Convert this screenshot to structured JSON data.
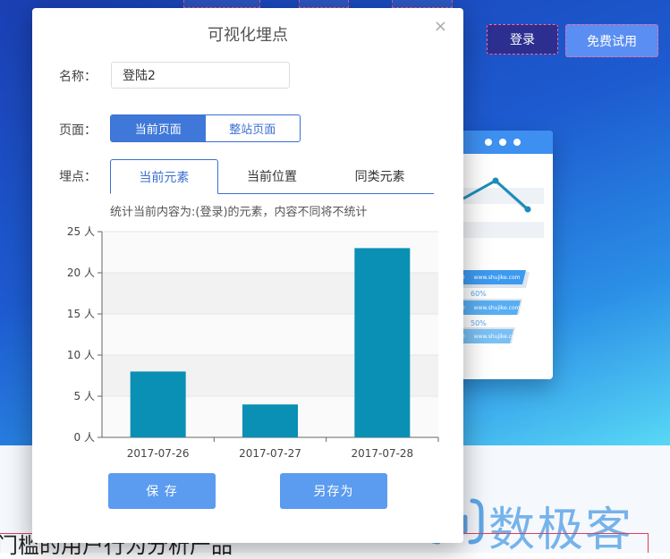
{
  "header": {
    "login_label": "登录",
    "trial_label": "免费试用"
  },
  "modal": {
    "title": "可视化埋点",
    "close_glyph": "×",
    "name_label": "名称：",
    "name_value": "登陆2",
    "page_label": "页面：",
    "page_options": [
      "当前页面",
      "整站页面"
    ],
    "page_selected": 0,
    "point_label": "埋点：",
    "point_tabs": [
      "当前元素",
      "当前位置",
      "同类元素"
    ],
    "point_selected": 0,
    "stat_note": "统计当前内容为:(登录)的元素，内容不同将不统计",
    "save_label": "保 存",
    "save_as_label": "另存为"
  },
  "chart_data": {
    "type": "bar",
    "categories": [
      "2017-07-26",
      "2017-07-27",
      "2017-07-28"
    ],
    "values": [
      8,
      4,
      23
    ],
    "ylim": [
      0,
      25
    ],
    "yticks": [
      "0 人",
      "5 人",
      "10 人",
      "15 人",
      "20 人",
      "25 人"
    ],
    "ytick_values": [
      0,
      5,
      10,
      15,
      20,
      25
    ],
    "bar_color": "#0a8fb5",
    "grid": true
  },
  "device": {
    "funnel_items": [
      "www.shujike.com",
      "www.shujike.com",
      "www.shujike.com"
    ],
    "funnel_prefix": [
      "00",
      "00",
      "00"
    ],
    "funnel_pcts": [
      "60%",
      "50%"
    ]
  },
  "logo": {
    "text": "数极客"
  },
  "page_bottom": {
    "text": "门槛的用户行为分析产品"
  },
  "colors": {
    "accent": "#3b6fd0",
    "button": "#5b9bf0",
    "bar": "#0a8fb5"
  }
}
